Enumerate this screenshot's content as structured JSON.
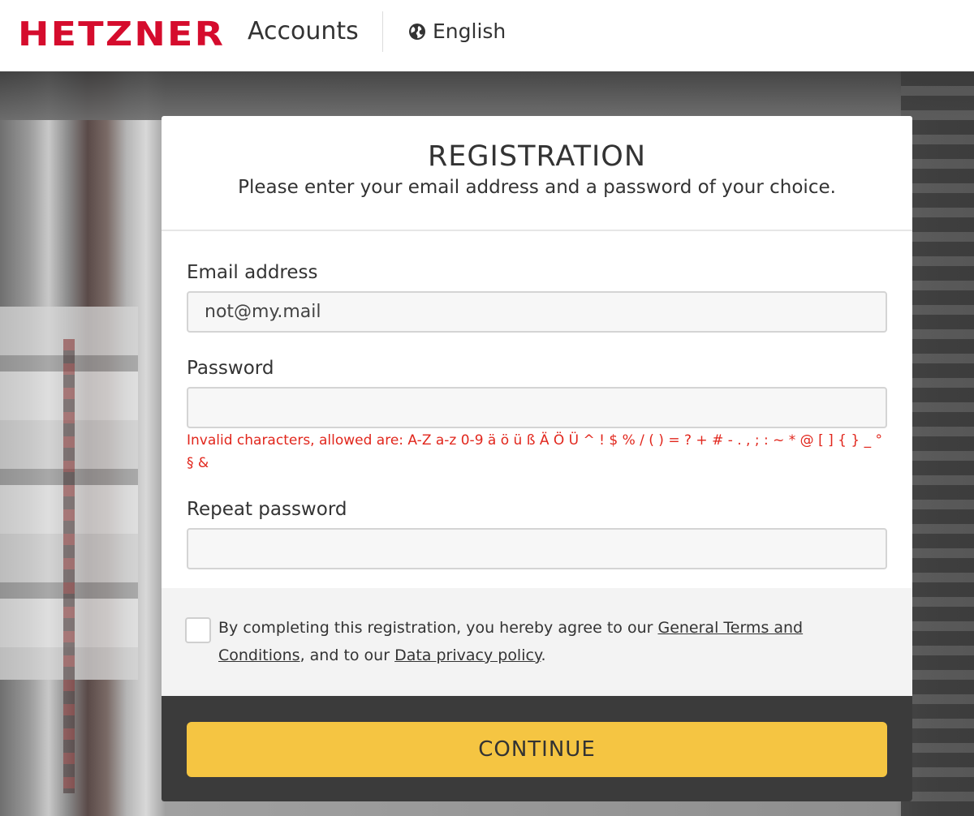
{
  "header": {
    "logo_text": "HETZNER",
    "app_name": "Accounts",
    "language": "English",
    "brand_color": "#d50c2d"
  },
  "card": {
    "title": "REGISTRATION",
    "subtitle": "Please enter your email address and a password of your choice.",
    "email": {
      "label": "Email address",
      "value": "not@my.mail"
    },
    "password": {
      "label": "Password",
      "value": "",
      "error": "Invalid characters, allowed are: A-Z a-z 0-9 ä ö ü ß Ä Ö Ü ^ ! $ % / ( ) = ? + # - . , ; : ~ * @ [ ] { } _ ° § &"
    },
    "repeat_password": {
      "label": "Repeat password",
      "value": ""
    },
    "consent": {
      "text_before": "By completing this registration, you hereby agree to our ",
      "terms_link": "General Terms and Conditions",
      "text_middle": ", and to our ",
      "privacy_link": "Data privacy policy",
      "text_after": ".",
      "checked": false
    },
    "continue_label": "CONTINUE",
    "continue_color": "#f5c542",
    "error_color": "#e1261c"
  },
  "icons": {
    "language": "globe-icon"
  }
}
